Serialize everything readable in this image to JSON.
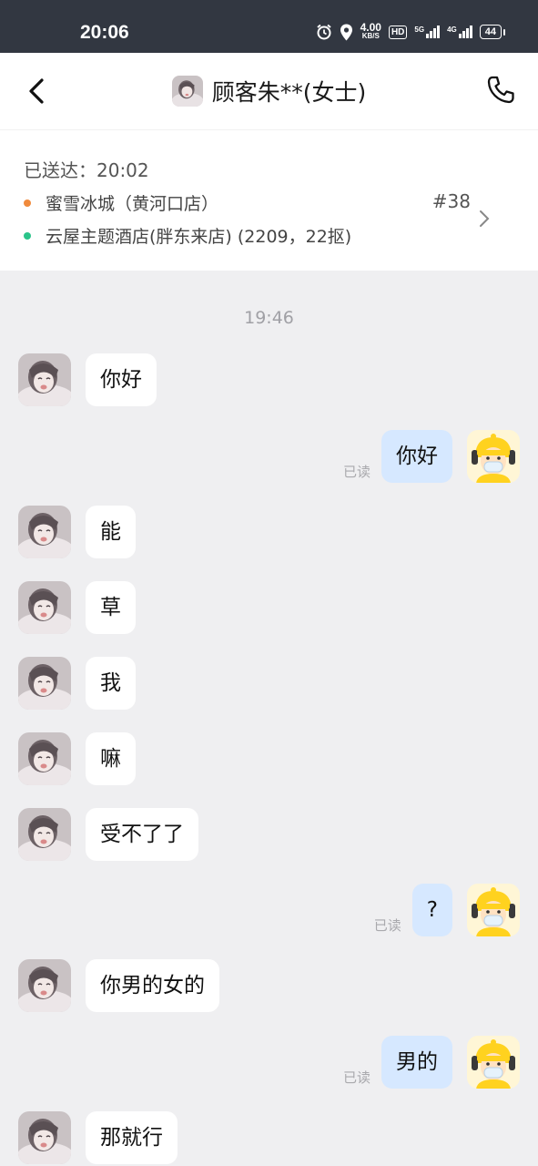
{
  "status_bar": {
    "time": "20:06",
    "speed_value": "4.00",
    "speed_unit": "KB/S",
    "hd_label": "HD",
    "net1": "5G",
    "net2": "4G",
    "battery": "44"
  },
  "header": {
    "title": "顾客朱**(女士)"
  },
  "order": {
    "status": "已送达：20:02",
    "pickup": "蜜雪冰城（黄河口店）",
    "dropoff": "云屋主题酒店(胖东来店) (2209，22抠)",
    "number": "#38",
    "pickup_dot_color": "#f08a3c",
    "dropoff_dot_color": "#2bc48a"
  },
  "chat": {
    "timestamp": "19:46",
    "read_label": "已读",
    "messages": [
      {
        "side": "left",
        "text": "你好"
      },
      {
        "side": "right",
        "text": "你好",
        "read": "已读"
      },
      {
        "side": "left",
        "text": "能"
      },
      {
        "side": "left",
        "text": "草"
      },
      {
        "side": "left",
        "text": "我"
      },
      {
        "side": "left",
        "text": "嘛"
      },
      {
        "side": "left",
        "text": "受不了了"
      },
      {
        "side": "right",
        "text": "?",
        "read": "已读"
      },
      {
        "side": "left",
        "text": "你男的女的"
      },
      {
        "side": "right",
        "text": "男的",
        "read": "已读"
      },
      {
        "side": "left",
        "text": "那就行"
      }
    ]
  },
  "icons": {
    "back": "chevron-left-icon",
    "phone": "phone-icon",
    "order_more": "chevron-right-icon",
    "alarm": "alarm-icon",
    "location": "location-icon"
  }
}
